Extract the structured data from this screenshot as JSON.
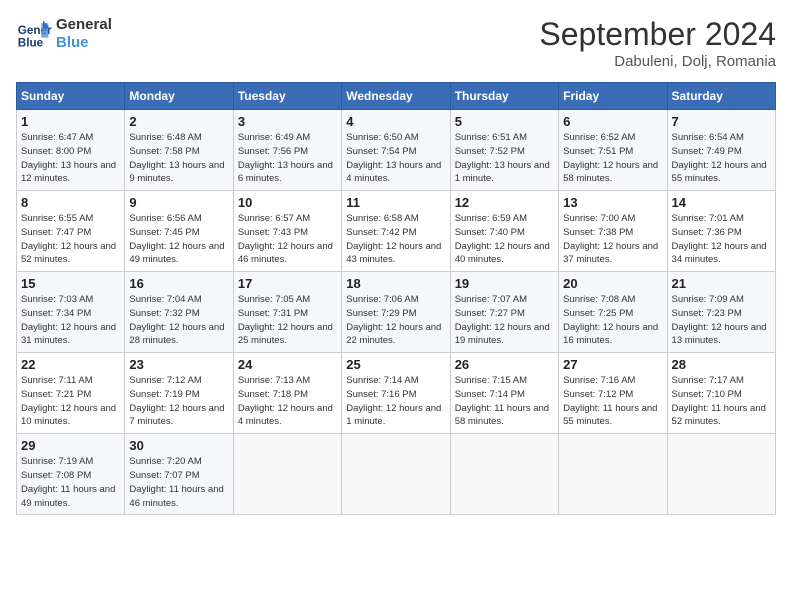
{
  "header": {
    "logo_line1": "General",
    "logo_line2": "Blue",
    "month": "September 2024",
    "location": "Dabuleni, Dolj, Romania"
  },
  "days_of_week": [
    "Sunday",
    "Monday",
    "Tuesday",
    "Wednesday",
    "Thursday",
    "Friday",
    "Saturday"
  ],
  "weeks": [
    [
      {
        "day": 1,
        "sunrise": "6:47 AM",
        "sunset": "8:00 PM",
        "daylight": "13 hours and 12 minutes."
      },
      {
        "day": 2,
        "sunrise": "6:48 AM",
        "sunset": "7:58 PM",
        "daylight": "13 hours and 9 minutes."
      },
      {
        "day": 3,
        "sunrise": "6:49 AM",
        "sunset": "7:56 PM",
        "daylight": "13 hours and 6 minutes."
      },
      {
        "day": 4,
        "sunrise": "6:50 AM",
        "sunset": "7:54 PM",
        "daylight": "13 hours and 4 minutes."
      },
      {
        "day": 5,
        "sunrise": "6:51 AM",
        "sunset": "7:52 PM",
        "daylight": "13 hours and 1 minute."
      },
      {
        "day": 6,
        "sunrise": "6:52 AM",
        "sunset": "7:51 PM",
        "daylight": "12 hours and 58 minutes."
      },
      {
        "day": 7,
        "sunrise": "6:54 AM",
        "sunset": "7:49 PM",
        "daylight": "12 hours and 55 minutes."
      }
    ],
    [
      {
        "day": 8,
        "sunrise": "6:55 AM",
        "sunset": "7:47 PM",
        "daylight": "12 hours and 52 minutes."
      },
      {
        "day": 9,
        "sunrise": "6:56 AM",
        "sunset": "7:45 PM",
        "daylight": "12 hours and 49 minutes."
      },
      {
        "day": 10,
        "sunrise": "6:57 AM",
        "sunset": "7:43 PM",
        "daylight": "12 hours and 46 minutes."
      },
      {
        "day": 11,
        "sunrise": "6:58 AM",
        "sunset": "7:42 PM",
        "daylight": "12 hours and 43 minutes."
      },
      {
        "day": 12,
        "sunrise": "6:59 AM",
        "sunset": "7:40 PM",
        "daylight": "12 hours and 40 minutes."
      },
      {
        "day": 13,
        "sunrise": "7:00 AM",
        "sunset": "7:38 PM",
        "daylight": "12 hours and 37 minutes."
      },
      {
        "day": 14,
        "sunrise": "7:01 AM",
        "sunset": "7:36 PM",
        "daylight": "12 hours and 34 minutes."
      }
    ],
    [
      {
        "day": 15,
        "sunrise": "7:03 AM",
        "sunset": "7:34 PM",
        "daylight": "12 hours and 31 minutes."
      },
      {
        "day": 16,
        "sunrise": "7:04 AM",
        "sunset": "7:32 PM",
        "daylight": "12 hours and 28 minutes."
      },
      {
        "day": 17,
        "sunrise": "7:05 AM",
        "sunset": "7:31 PM",
        "daylight": "12 hours and 25 minutes."
      },
      {
        "day": 18,
        "sunrise": "7:06 AM",
        "sunset": "7:29 PM",
        "daylight": "12 hours and 22 minutes."
      },
      {
        "day": 19,
        "sunrise": "7:07 AM",
        "sunset": "7:27 PM",
        "daylight": "12 hours and 19 minutes."
      },
      {
        "day": 20,
        "sunrise": "7:08 AM",
        "sunset": "7:25 PM",
        "daylight": "12 hours and 16 minutes."
      },
      {
        "day": 21,
        "sunrise": "7:09 AM",
        "sunset": "7:23 PM",
        "daylight": "12 hours and 13 minutes."
      }
    ],
    [
      {
        "day": 22,
        "sunrise": "7:11 AM",
        "sunset": "7:21 PM",
        "daylight": "12 hours and 10 minutes."
      },
      {
        "day": 23,
        "sunrise": "7:12 AM",
        "sunset": "7:19 PM",
        "daylight": "12 hours and 7 minutes."
      },
      {
        "day": 24,
        "sunrise": "7:13 AM",
        "sunset": "7:18 PM",
        "daylight": "12 hours and 4 minutes."
      },
      {
        "day": 25,
        "sunrise": "7:14 AM",
        "sunset": "7:16 PM",
        "daylight": "12 hours and 1 minute."
      },
      {
        "day": 26,
        "sunrise": "7:15 AM",
        "sunset": "7:14 PM",
        "daylight": "11 hours and 58 minutes."
      },
      {
        "day": 27,
        "sunrise": "7:16 AM",
        "sunset": "7:12 PM",
        "daylight": "11 hours and 55 minutes."
      },
      {
        "day": 28,
        "sunrise": "7:17 AM",
        "sunset": "7:10 PM",
        "daylight": "11 hours and 52 minutes."
      }
    ],
    [
      {
        "day": 29,
        "sunrise": "7:19 AM",
        "sunset": "7:08 PM",
        "daylight": "11 hours and 49 minutes."
      },
      {
        "day": 30,
        "sunrise": "7:20 AM",
        "sunset": "7:07 PM",
        "daylight": "11 hours and 46 minutes."
      },
      null,
      null,
      null,
      null,
      null
    ]
  ]
}
